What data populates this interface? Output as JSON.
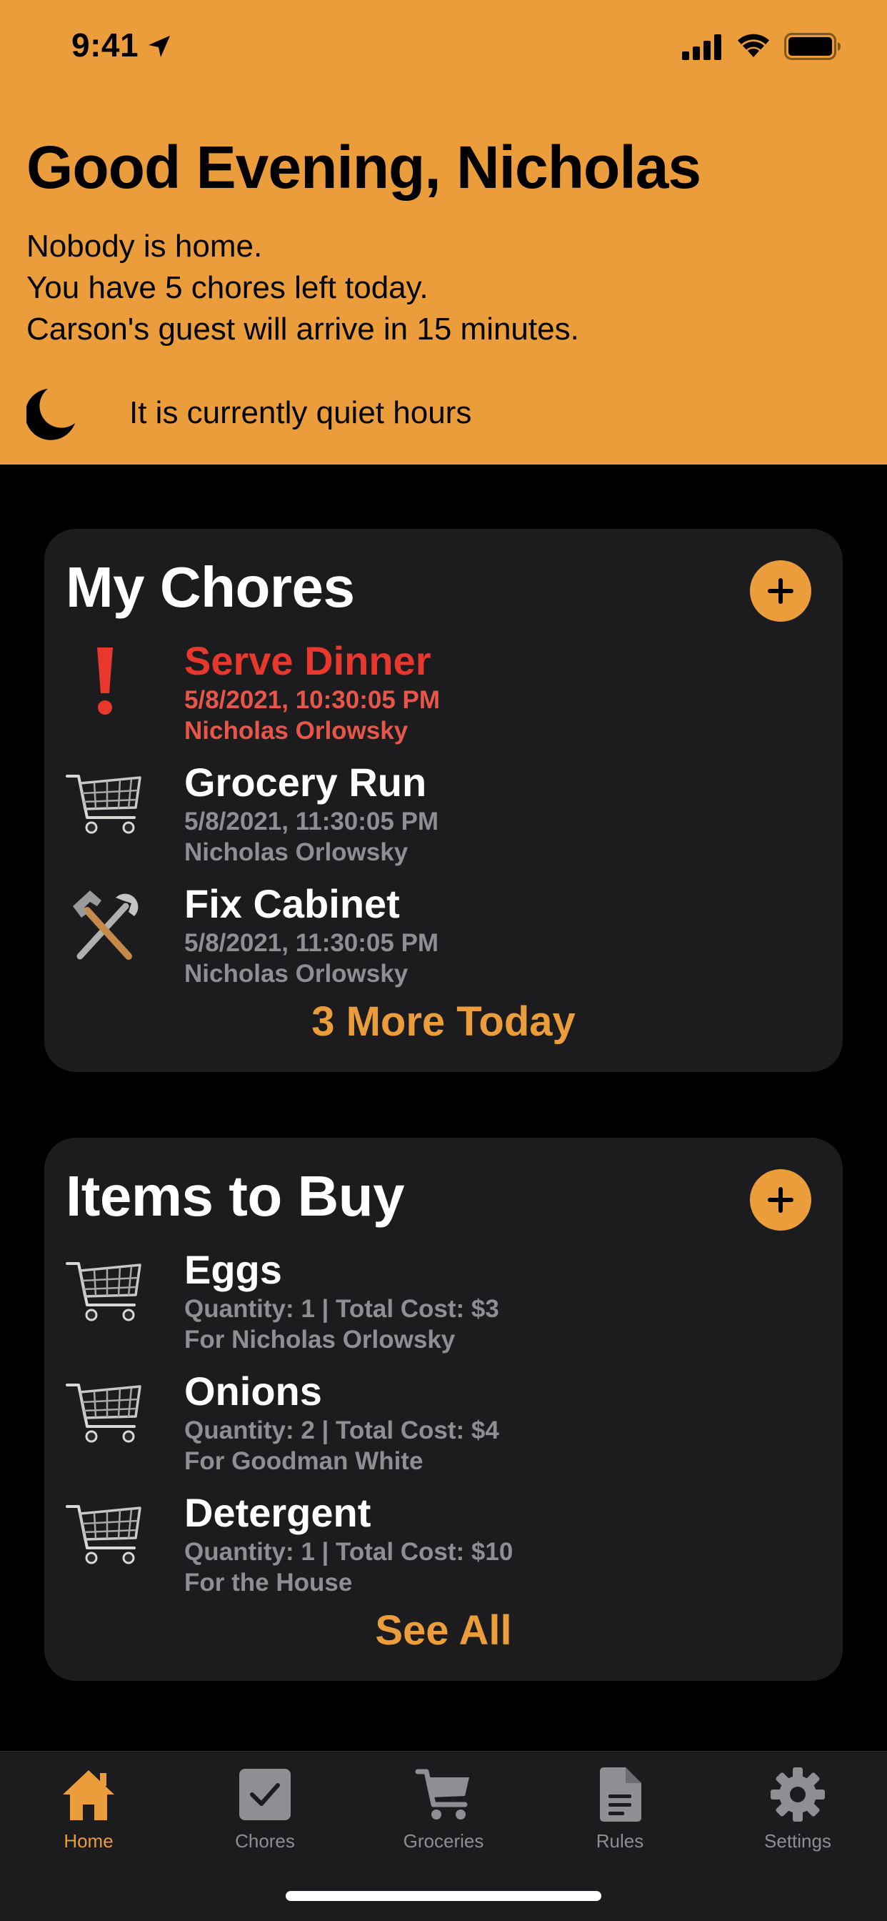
{
  "status_bar": {
    "time": "9:41"
  },
  "header": {
    "greeting": "Good Evening, Nicholas",
    "status_lines": [
      "Nobody is home.",
      "You have 5 chores left today.",
      "Carson's guest will arrive in 15 minutes."
    ],
    "quiet_hours_text": "It is currently quiet hours"
  },
  "chores_card": {
    "title": "My Chores",
    "items": [
      {
        "icon": "exclamation-icon",
        "title": "Serve Dinner",
        "datetime": "5/8/2021, 10:30:05 PM",
        "assignee": "Nicholas Orlowsky",
        "overdue": true
      },
      {
        "icon": "shopping-cart-icon",
        "title": "Grocery Run",
        "datetime": "5/8/2021, 11:30:05 PM",
        "assignee": "Nicholas Orlowsky",
        "overdue": false
      },
      {
        "icon": "hammer-wrench-icon",
        "title": "Fix Cabinet",
        "datetime": "5/8/2021, 11:30:05 PM",
        "assignee": "Nicholas Orlowsky",
        "overdue": false
      }
    ],
    "more_label": "3 More Today"
  },
  "groceries_card": {
    "title": "Items to Buy",
    "items": [
      {
        "icon": "shopping-cart-icon",
        "title": "Eggs",
        "details": "Quantity: 1 | Total Cost: $3",
        "for_label": "For Nicholas Orlowsky"
      },
      {
        "icon": "shopping-cart-icon",
        "title": "Onions",
        "details": "Quantity: 2 | Total Cost: $4",
        "for_label": "For Goodman White"
      },
      {
        "icon": "shopping-cart-icon",
        "title": "Detergent",
        "details": "Quantity: 1 | Total Cost: $10",
        "for_label": "For the House"
      }
    ],
    "more_label": "See All"
  },
  "tab_bar": {
    "tabs": [
      {
        "label": "Home",
        "icon": "house-icon",
        "active": true
      },
      {
        "label": "Chores",
        "icon": "checkbox-icon",
        "active": false
      },
      {
        "label": "Groceries",
        "icon": "cart-icon",
        "active": false
      },
      {
        "label": "Rules",
        "icon": "document-icon",
        "active": false
      },
      {
        "label": "Settings",
        "icon": "gear-icon",
        "active": false
      }
    ]
  },
  "colors": {
    "accent": "#EA9D3A",
    "background": "#000000",
    "card": "#1C1C1E",
    "overdue": "#E8382D",
    "secondary_text": "#8E8E93"
  }
}
